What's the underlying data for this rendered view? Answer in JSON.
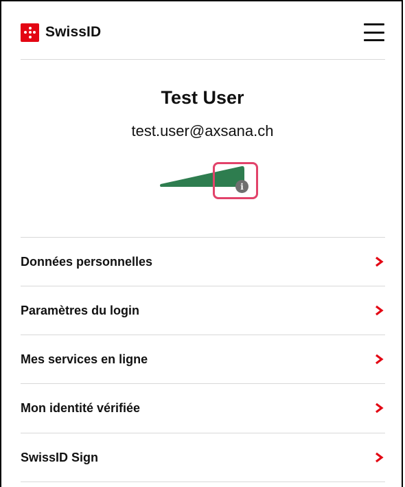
{
  "app": {
    "brand_name": "SwissID",
    "brand_color": "#e30613"
  },
  "header": {
    "logo_icon": "swissid-logo-icon",
    "menu_icon": "hamburger-menu-icon"
  },
  "profile": {
    "name": "Test User",
    "email": "test.user@axsana.ch",
    "security_level_icon": "security-level-meter",
    "security_level_color": "#2e7d4f",
    "info_icon": "info-icon",
    "highlight_color": "#e2426a"
  },
  "nav": {
    "items": [
      {
        "label": "Données personnelles"
      },
      {
        "label": "Paramètres du login"
      },
      {
        "label": "Mes services en ligne"
      },
      {
        "label": "Mon identité vérifiée"
      },
      {
        "label": "SwissID Sign"
      }
    ],
    "chevron_icon": "chevron-right-icon",
    "chevron_color": "#e30613"
  }
}
